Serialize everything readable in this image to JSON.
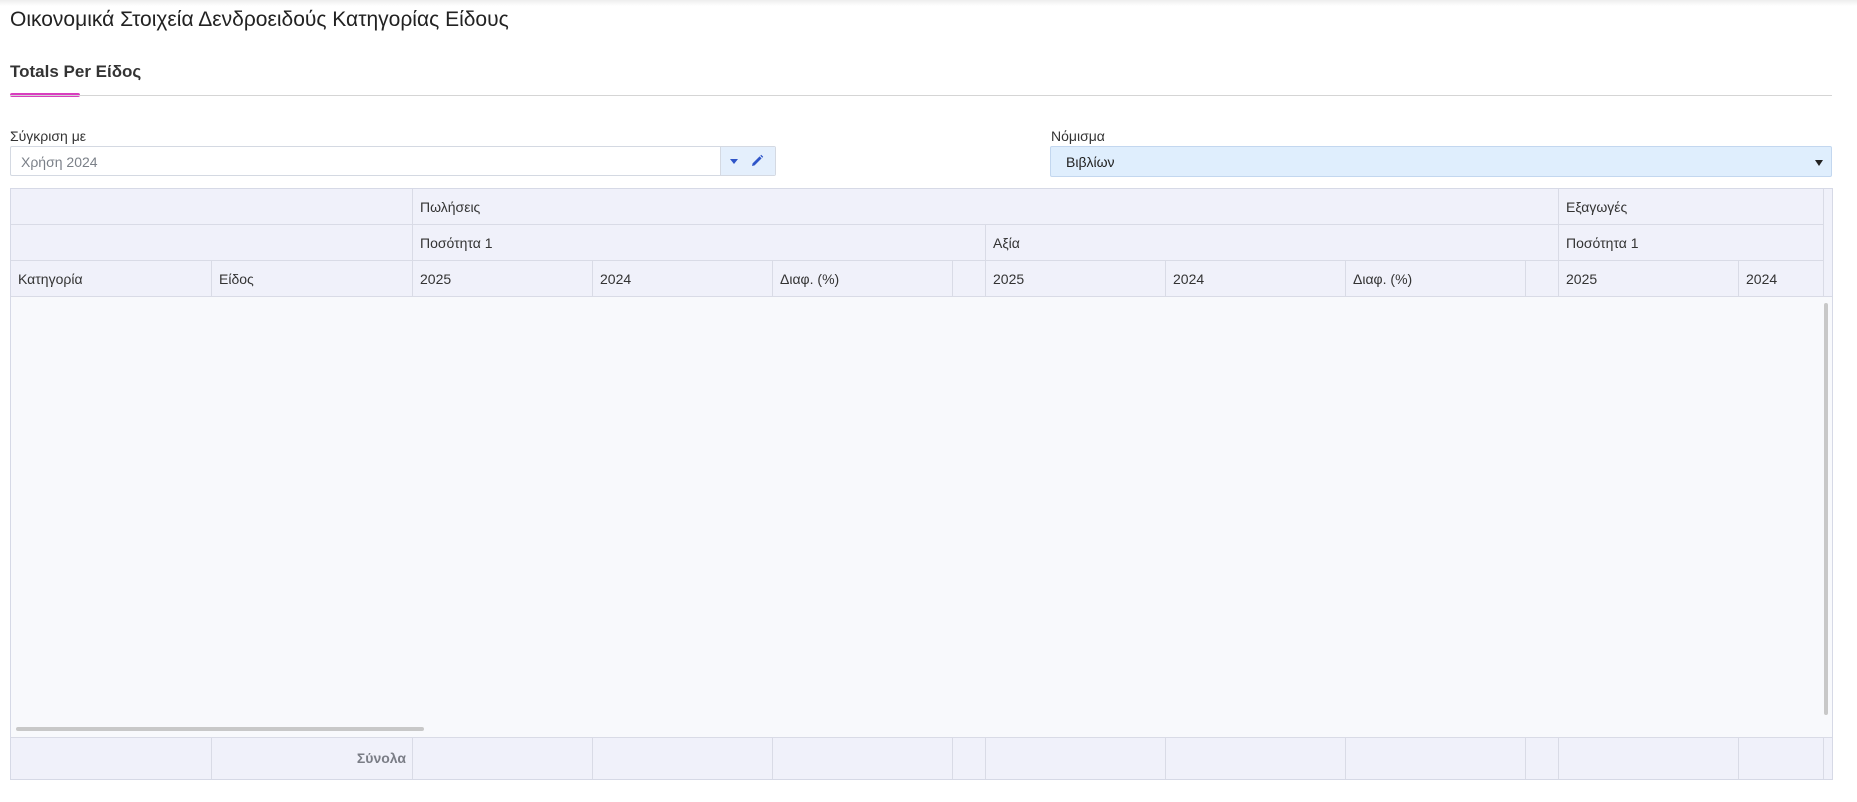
{
  "page": {
    "title": "Οικονομικά Στοιχεία Δενδροειδούς Κατηγορίας Είδους"
  },
  "tabs": [
    {
      "label": "Totals Per Είδος",
      "active": true
    }
  ],
  "accent_color": "#d93fbf",
  "filters": {
    "compare": {
      "label": "Σύγκριση με",
      "value": "Χρήση 2024"
    },
    "currency": {
      "label": "Νόμισμα",
      "value": "Βιβλίων"
    }
  },
  "grid": {
    "group_headers": {
      "sales": "Πωλήσεις",
      "exports": "Εξαγωγές"
    },
    "sub_headers": {
      "sales_qty": "Ποσότητα 1",
      "sales_value": "Αξία",
      "exports_qty": "Ποσότητα 1"
    },
    "columns": {
      "category": "Κατηγορία",
      "item": "Είδος",
      "sales_qty_2025": "2025",
      "sales_qty_2024": "2024",
      "sales_qty_diff": "Διαφ. (%)",
      "sales_value_2025": "2025",
      "sales_value_2024": "2024",
      "sales_value_diff": "Διαφ. (%)",
      "exports_qty_2025": "2025",
      "exports_qty_2024": "2024"
    },
    "rows": [],
    "footer": {
      "totals_label": "Σύνολα"
    }
  }
}
